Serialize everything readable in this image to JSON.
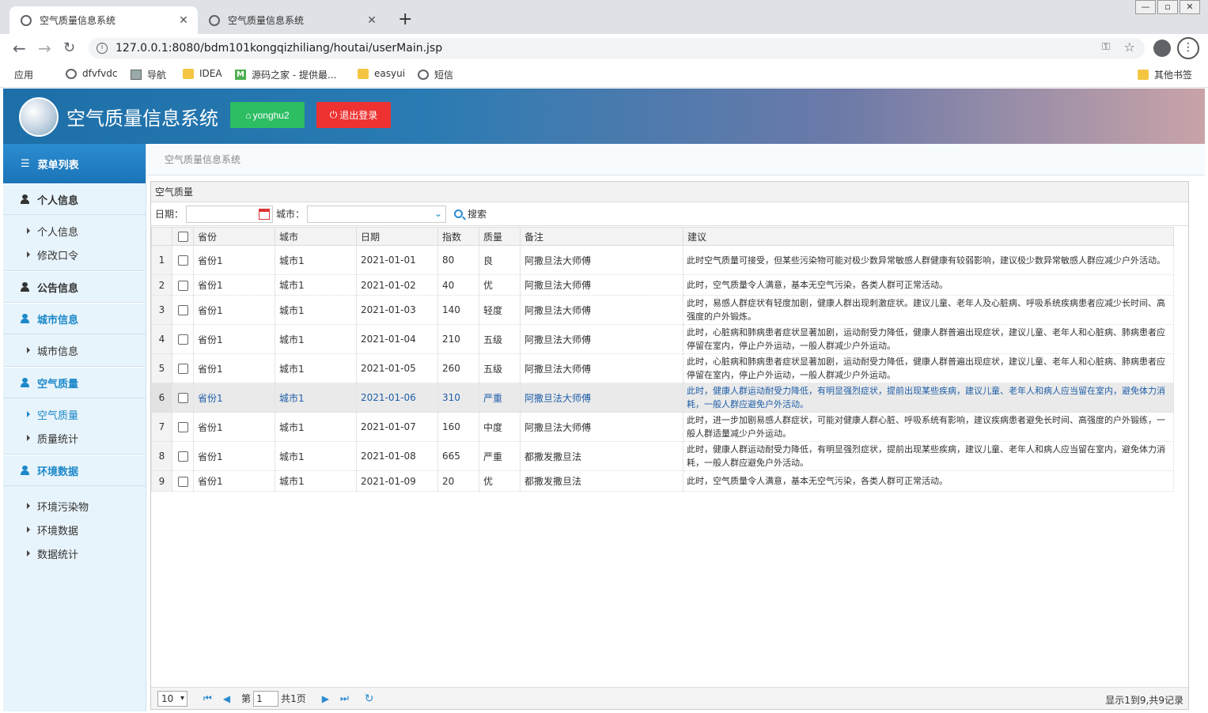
{
  "browser": {
    "tabs": [
      {
        "title": "空气质量信息系统",
        "active": true
      },
      {
        "title": "空气质量信息系统",
        "active": false
      }
    ],
    "new_tab": "+",
    "url": "127.0.0.1:8080/bdm101kongqizhiliang/houtai/userMain.jsp",
    "bookmarks": [
      "应用",
      "dfvfvdc",
      "导航",
      "IDEA",
      "源码之家 - 提供最...",
      "easyui",
      "短信"
    ],
    "other_bookmarks": "其他书签"
  },
  "app": {
    "title": "空气质量信息系统",
    "user_button": "yonghu2",
    "logout_button": "退出登录",
    "colors": {
      "primary": "#1b88c9",
      "user_btn": "#2dbd63",
      "logout_btn": "#ee3232"
    }
  },
  "sidebar": {
    "header": "菜单列表",
    "groups": [
      {
        "label": "个人信息",
        "items": [
          "个人信息",
          "修改口令"
        ]
      },
      {
        "label": "公告信息",
        "items": []
      },
      {
        "label": "城市信息",
        "items": [
          "城市信息"
        ]
      },
      {
        "label": "空气质量",
        "items": [
          "空气质量",
          "质量统计"
        ]
      },
      {
        "label": "环境数据",
        "items": [
          "环境污染物",
          "环境数据",
          "数据统计"
        ]
      }
    ]
  },
  "breadcrumb": "空气质量信息系统",
  "panel": {
    "title": "空气质量",
    "date_label": "日期：",
    "city_label": "城市：",
    "search_button": "搜索",
    "columns": [
      "省份",
      "城市",
      "日期",
      "指数",
      "质量",
      "备注",
      "建议"
    ],
    "rows": [
      {
        "n": "1",
        "province": "省份1",
        "city": "城市1",
        "date": "2021-01-01",
        "index": "80",
        "quality": "良",
        "note": "阿撒旦法大师傅",
        "advice": "此时空气质量可接受，但某些污染物可能对极少数异常敏感人群健康有较弱影响，建议极少数异常敏感人群应减少户外活动。"
      },
      {
        "n": "2",
        "province": "省份1",
        "city": "城市1",
        "date": "2021-01-02",
        "index": "40",
        "quality": "优",
        "note": "阿撒旦法大师傅",
        "advice": "此时，空气质量令人满意，基本无空气污染，各类人群可正常活动。"
      },
      {
        "n": "3",
        "province": "省份1",
        "city": "城市1",
        "date": "2021-01-03",
        "index": "140",
        "quality": "轻度",
        "note": "阿撒旦法大师傅",
        "advice": "此时，易感人群症状有轻度加剧，健康人群出现刺激症状。建议儿童、老年人及心脏病、呼吸系统疾病患者应减少长时间、高强度的户外锻炼。"
      },
      {
        "n": "4",
        "province": "省份1",
        "city": "城市1",
        "date": "2021-01-04",
        "index": "210",
        "quality": "五级",
        "note": "阿撒旦法大师傅",
        "advice": "此时，心脏病和肺病患者症状显著加剧，运动耐受力降低，健康人群普遍出现症状，建议儿童、老年人和心脏病、肺病患者应停留在室内，停止户外运动，一般人群减少户外运动。"
      },
      {
        "n": "5",
        "province": "省份1",
        "city": "城市1",
        "date": "2021-01-05",
        "index": "260",
        "quality": "五级",
        "note": "阿撒旦法大师傅",
        "advice": "此时，心脏病和肺病患者症状显著加剧，运动耐受力降低，健康人群普遍出现症状，建议儿童、老年人和心脏病、肺病患者应停留在室内，停止户外运动，一般人群减少户外运动。"
      },
      {
        "n": "6",
        "province": "省份1",
        "city": "城市1",
        "date": "2021-01-06",
        "index": "310",
        "quality": "严重",
        "note": "阿撒旦法大师傅",
        "advice": "此时，健康人群运动耐受力降低，有明显强烈症状，提前出现某些疾病，建议儿童、老年人和病人应当留在室内，避免体力消耗，一般人群应避免户外活动。"
      },
      {
        "n": "7",
        "province": "省份1",
        "city": "城市1",
        "date": "2021-01-07",
        "index": "160",
        "quality": "中度",
        "note": "阿撒旦法大师傅",
        "advice": "此时，进一步加剧易感人群症状，可能对健康人群心脏、呼吸系统有影响，建议疾病患者避免长时间、高强度的户外锻练，一般人群适量减少户外运动。"
      },
      {
        "n": "8",
        "province": "省份1",
        "city": "城市1",
        "date": "2021-01-08",
        "index": "665",
        "quality": "严重",
        "note": "都撒发撒旦法",
        "advice": "此时，健康人群运动耐受力降低，有明显强烈症状，提前出现某些疾病，建议儿童、老年人和病人应当留在室内，避免体力消耗，一般人群应避免户外活动。"
      },
      {
        "n": "9",
        "province": "省份1",
        "city": "城市1",
        "date": "2021-01-09",
        "index": "20",
        "quality": "优",
        "note": "都撒发撒旦法",
        "advice": "此时，空气质量令人满意，基本无空气污染，各类人群可正常活动。"
      }
    ],
    "selected_row": 6,
    "pager": {
      "page_size": "10",
      "page_label": "第",
      "page": "1",
      "total_pages": "共1页",
      "info": "显示1到9,共9记录"
    }
  }
}
